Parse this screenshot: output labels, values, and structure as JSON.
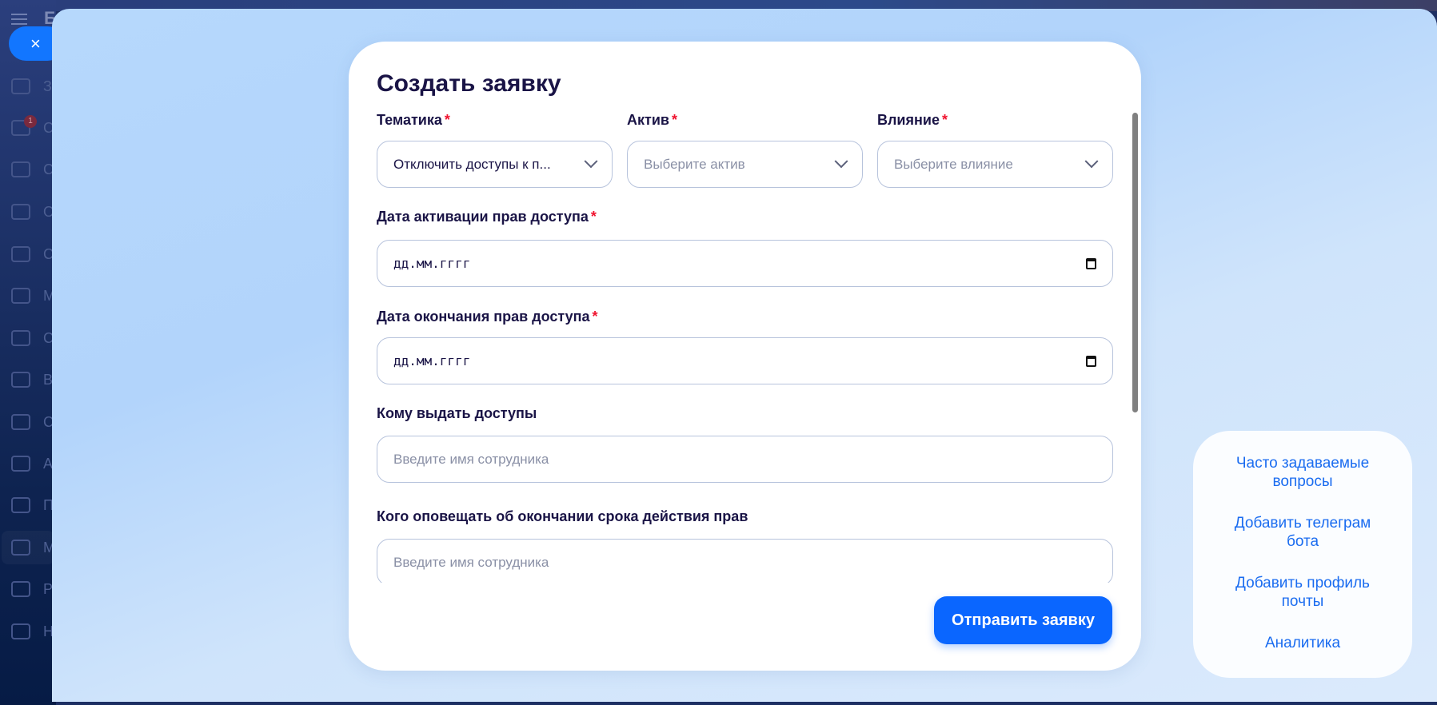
{
  "app": {
    "brand_letter": "Б",
    "close_icon": "×"
  },
  "sidebar": {
    "items": [
      {
        "icon": "checkbox-icon",
        "label": "За"
      },
      {
        "icon": "workflow-icon",
        "label": "С",
        "badge": "1"
      },
      {
        "icon": "funnel-icon",
        "label": "С"
      },
      {
        "icon": "calendar-icon",
        "label": "О"
      },
      {
        "icon": "warehouse-icon",
        "label": "С"
      },
      {
        "icon": "target-icon",
        "label": "М"
      },
      {
        "icon": "cart-icon",
        "label": "С"
      },
      {
        "icon": "chart-icon",
        "label": "В"
      },
      {
        "icon": "id-card-icon",
        "label": "С"
      },
      {
        "icon": "robot-icon",
        "label": "А"
      },
      {
        "icon": "box-icon",
        "label": "П"
      },
      {
        "icon": "brand-icon",
        "label": "М"
      },
      {
        "icon": "code-icon",
        "label": "Р"
      },
      {
        "icon": "gear-icon",
        "label": "Н"
      }
    ]
  },
  "form": {
    "title": "Создать заявку",
    "required_mark": "*",
    "topic": {
      "label": "Тематика",
      "value": "Отключить доступы к п..."
    },
    "asset": {
      "label": "Актив",
      "placeholder": "Выберите актив"
    },
    "impact": {
      "label": "Влияние",
      "placeholder": "Выберите влияние"
    },
    "start_date": {
      "label": "Дата активации прав доступа",
      "placeholder": "дд.мм.гггг"
    },
    "end_date": {
      "label": "Дата окончания прав доступа",
      "placeholder": "дд.мм.гггг"
    },
    "grantee": {
      "label": "Кому выдать доступы",
      "placeholder": "Введите имя сотрудника"
    },
    "notify": {
      "label": "Кого оповещать об окончании срока действия прав",
      "placeholder": "Введите имя сотрудника"
    },
    "submit_label": "Отправить заявку"
  },
  "side_links": [
    "Часто задаваемые вопросы",
    "Добавить телеграм бота",
    "Добавить профиль почты",
    "Аналитика"
  ]
}
